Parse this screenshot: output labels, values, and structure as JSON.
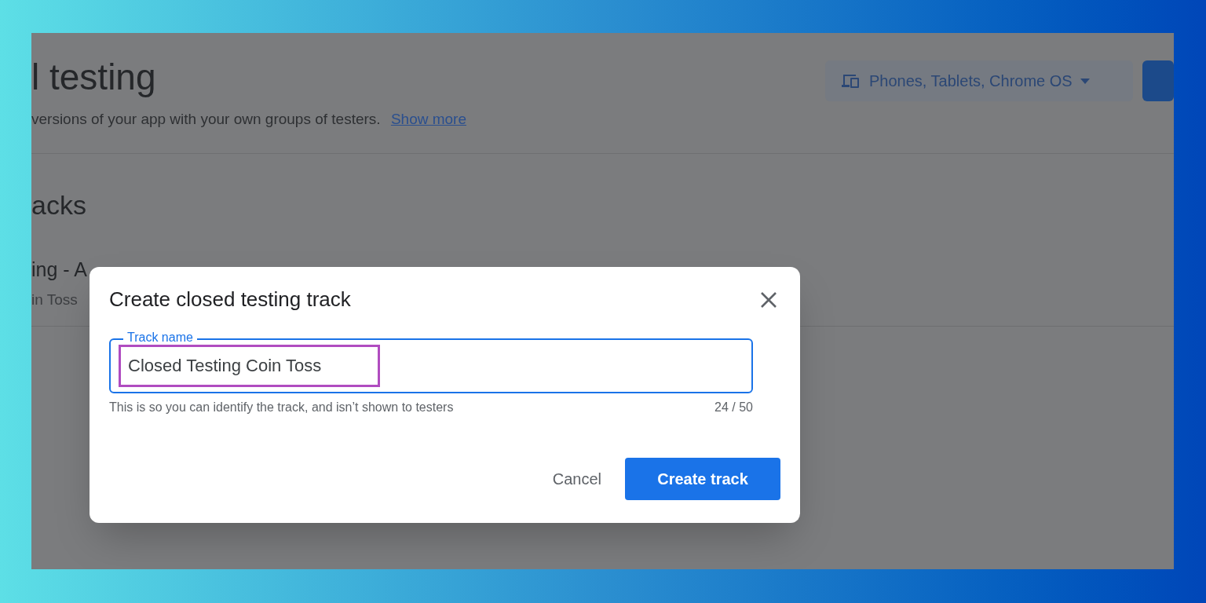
{
  "page": {
    "title": "l testing",
    "description": "versions of your app with your own groups of testers.",
    "link": "Show more",
    "section_title": "acks",
    "track": {
      "name": "ing - A",
      "subtitle": "in Toss"
    },
    "device_selector": {
      "label": "Phones, Tablets, Chrome OS"
    }
  },
  "dialog": {
    "title": "Create closed testing track",
    "field": {
      "label": "Track name",
      "value": "Closed Testing Coin Toss",
      "helper": "This is so you can identify the track, and isn’t shown to testers",
      "counter": "24 / 50"
    },
    "buttons": [
      {
        "label": "Cancel",
        "kind": "text"
      },
      {
        "label": "Create track",
        "kind": "primary"
      }
    ]
  }
}
